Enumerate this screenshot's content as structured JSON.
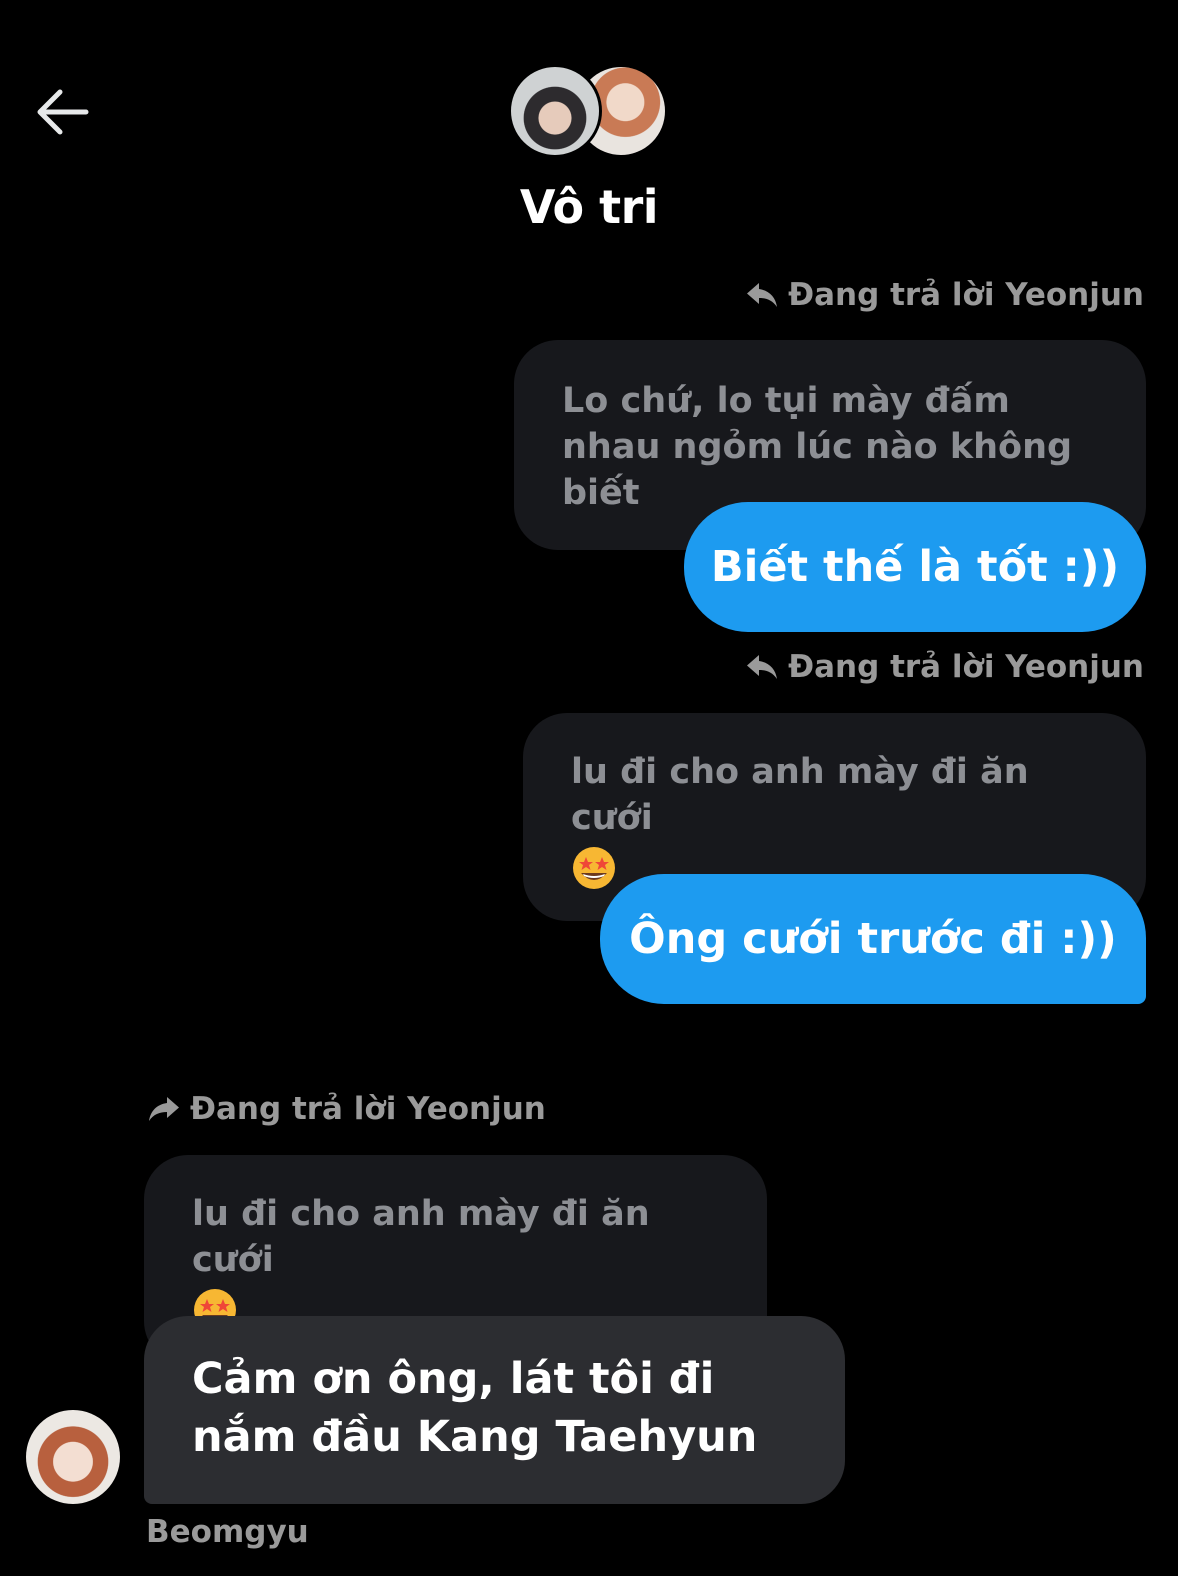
{
  "header": {
    "back_icon": "arrow-left-icon",
    "title": "Vô tri"
  },
  "messages": [
    {
      "reply_label": "Đang trả lời Yeonjun",
      "quoted_text": "Lo chứ, lo tụi mày đấm nhau ngỏm lúc nào không biết",
      "text": "Biết thế là tốt :))",
      "side": "outgoing"
    },
    {
      "reply_label": "Đang trả lời Yeonjun",
      "quoted_text": "lu đi cho anh mày đi ăn cưới",
      "quoted_emoji": "star-struck-emoji",
      "text": "Ông cưới trước đi :))",
      "side": "outgoing"
    },
    {
      "reply_label": "Đang trả lời Yeonjun",
      "quoted_text": "lu đi cho anh mày đi ăn cưới",
      "quoted_emoji": "star-struck-emoji",
      "text": "Cảm ơn ông, lát tôi đi nắm đầu Kang Taehyun",
      "side": "incoming",
      "sender": "Beomgyu"
    }
  ],
  "colors": {
    "background": "#000000",
    "outgoing_bubble": "#1d9bf0",
    "incoming_bubble": "#2c2d31",
    "quote_bubble": "#17181c",
    "muted_text": "#9a9a9a"
  }
}
